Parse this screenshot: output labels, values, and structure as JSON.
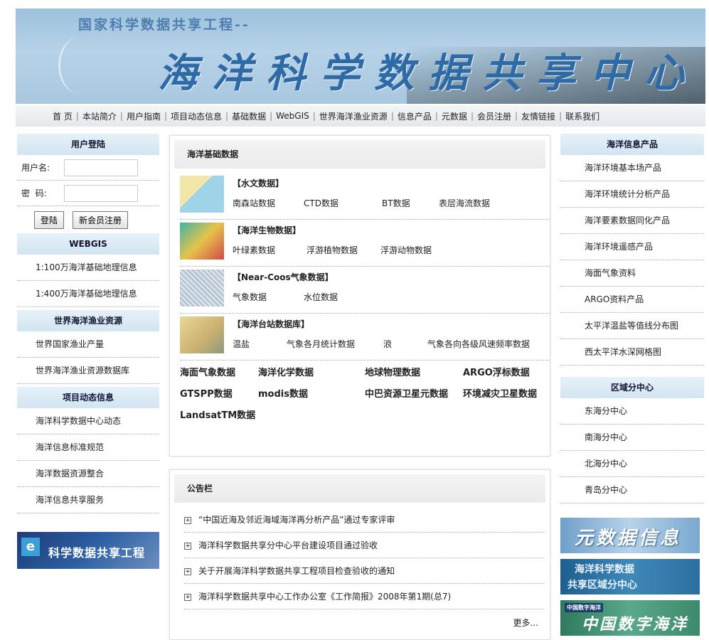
{
  "banner": {
    "subtitle": "国家科学数据共享工程--",
    "title": "海洋科学数据共享中心"
  },
  "nav": [
    "首 页",
    "本站简介",
    "用户指南",
    "项目动态信息",
    "基础数据",
    "WebGIS",
    "世界海洋渔业资源",
    "信息产品",
    "元数据",
    "会员注册",
    "友情链接",
    "联系我们"
  ],
  "login": {
    "title": "用户登陆",
    "username_label": "用户名:",
    "password_label": "密  码:",
    "username_value": "",
    "password_value": "",
    "login_button": "登陆",
    "register_button": "新会员注册"
  },
  "webgis": {
    "title": "WEBGIS",
    "items": [
      "1:100万海洋基础地理信息",
      "1:400万海洋基础地理信息"
    ]
  },
  "fishery": {
    "title": "世界海洋渔业资源",
    "items": [
      "世界国家渔业产量",
      "世界海洋渔业资源数据库"
    ]
  },
  "project": {
    "title": "项目动态信息",
    "items": [
      "海洋科学数据中心动态",
      "海洋信息标准规范",
      "海洋数据资源整合",
      "海洋信息共享服务"
    ]
  },
  "left_banner": {
    "text": "科学数据共享工程",
    "logo": "e"
  },
  "basic_data": {
    "title": "海洋基础数据",
    "categories": [
      {
        "title": "【水文数据】",
        "links": [
          "南森站数据",
          "CTD数据",
          "BT数据",
          "表层海流数据"
        ],
        "thumb_color": "#f2e6a8"
      },
      {
        "title": "【海洋生物数据】",
        "links": [
          "叶绿素数据",
          "浮游植物数据",
          "浮游动物数据"
        ],
        "thumb_color": "#3fb5a0"
      },
      {
        "title": "【Near-Coos气象数据】",
        "links": [
          "气象数据",
          "水位数据"
        ],
        "thumb_color": "#d9e2ea"
      },
      {
        "title": "【海洋台站数据库】",
        "links": [
          "温盐",
          "气象各月统计数据",
          "浪",
          "气象各向各级风速频率数据"
        ],
        "thumb_color": "#e8d898"
      }
    ],
    "big_links": [
      [
        "海面气象数据",
        "海洋化学数据",
        "地球物理数据",
        "ARGO浮标数据"
      ],
      [
        "GTSPP数据",
        "modis数据",
        "中巴资源卫星元数据",
        "环境减灾卫星数据"
      ],
      [
        "LandsatTM数据"
      ]
    ]
  },
  "notices": {
    "title": "公告栏",
    "items": [
      "“中国近海及邻近海域海洋再分析产品”通过专家评审",
      "海洋科学数据共享分中心平台建设项目通过验收",
      "关于开展海洋科学数据共享工程项目检查验收的通知",
      "海洋科学数据共享中心工作办公室《工作简报》2008年第1期(总7)"
    ],
    "more": "更多..."
  },
  "products": {
    "title": "海洋信息产品",
    "items": [
      "海洋环境基本场产品",
      "海洋环境统计分析产品",
      "海洋要素数据同化产品",
      "海洋环境遥感产品",
      "海面气象资料",
      "ARGO资料产品",
      "太平洋温盐等值线分布图",
      "西太平洋水深网格图"
    ]
  },
  "regional": {
    "title": "区域分中心",
    "items": [
      "东海分中心",
      "南海分中心",
      "北海分中心",
      "青岛分中心"
    ]
  },
  "right_banners": {
    "metadata": "元数据信息",
    "regional_line1": "海洋科学数据",
    "regional_line2": "共享区域分中心",
    "ocean": "中国数字海洋",
    "ocean_logo": "中国数字海洋"
  }
}
